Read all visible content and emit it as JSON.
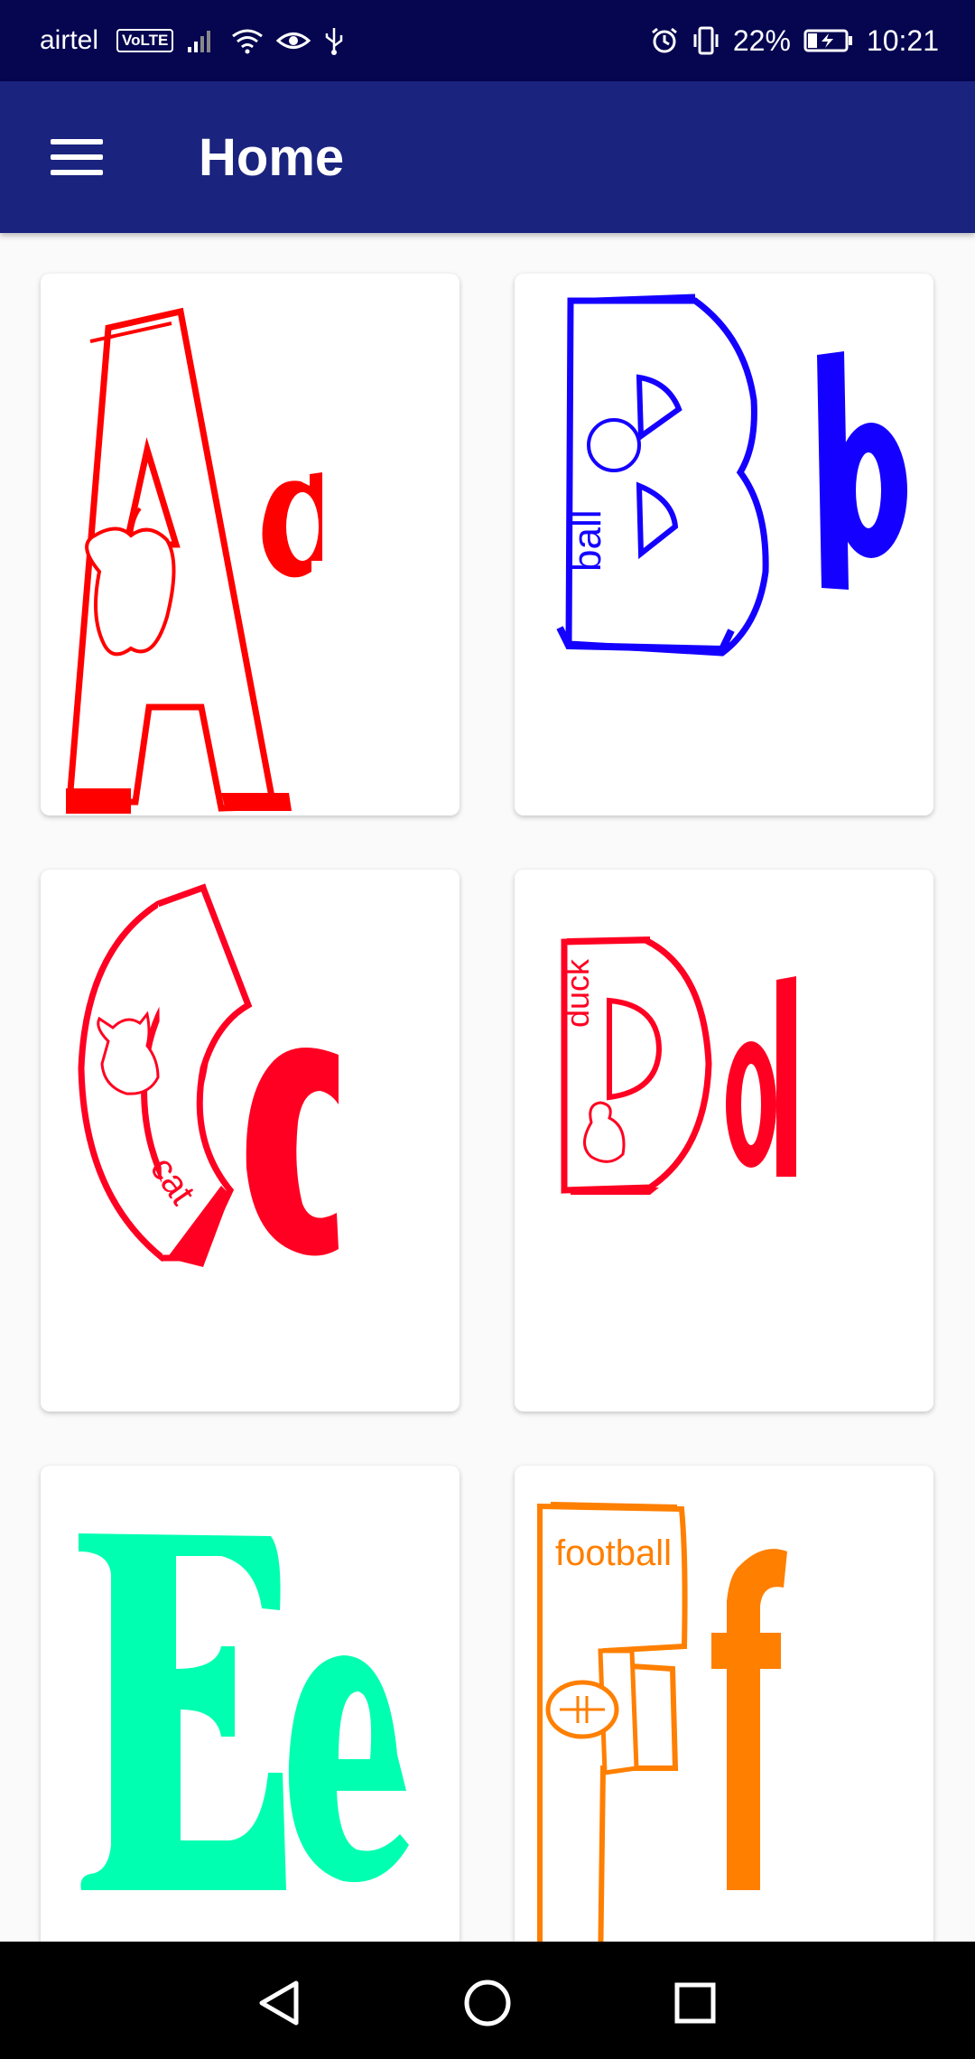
{
  "status_bar": {
    "carrier": "airtel",
    "network_badge": "VoLTE",
    "battery": "22%",
    "time": "10:21",
    "icons": [
      "signal-icon",
      "wifi-icon",
      "eye-icon",
      "usb-icon",
      "alarm-icon",
      "vibrate-icon",
      "battery-charging-icon"
    ]
  },
  "app_bar": {
    "title": "Home",
    "menu_icon": "hamburger-menu-icon"
  },
  "cards": [
    {
      "upper": "A",
      "lower": "a",
      "word": "",
      "picture": "apple",
      "color": "#ff0000"
    },
    {
      "upper": "B",
      "lower": "b",
      "word": "ball",
      "picture": "ball",
      "color": "#1400ff"
    },
    {
      "upper": "C",
      "lower": "c",
      "word": "cat",
      "picture": "cat",
      "color": "#ff0022"
    },
    {
      "upper": "D",
      "lower": "d",
      "word": "duck",
      "picture": "duck",
      "color": "#ff0022"
    },
    {
      "upper": "E",
      "lower": "e",
      "word": "",
      "picture": "",
      "color": "#00ffb0"
    },
    {
      "upper": "F",
      "lower": "f",
      "word": "football",
      "picture": "football",
      "color": "#ff7f00"
    }
  ],
  "nav_bar": {
    "back": "back-icon",
    "home": "home-icon",
    "recents": "recents-icon"
  }
}
